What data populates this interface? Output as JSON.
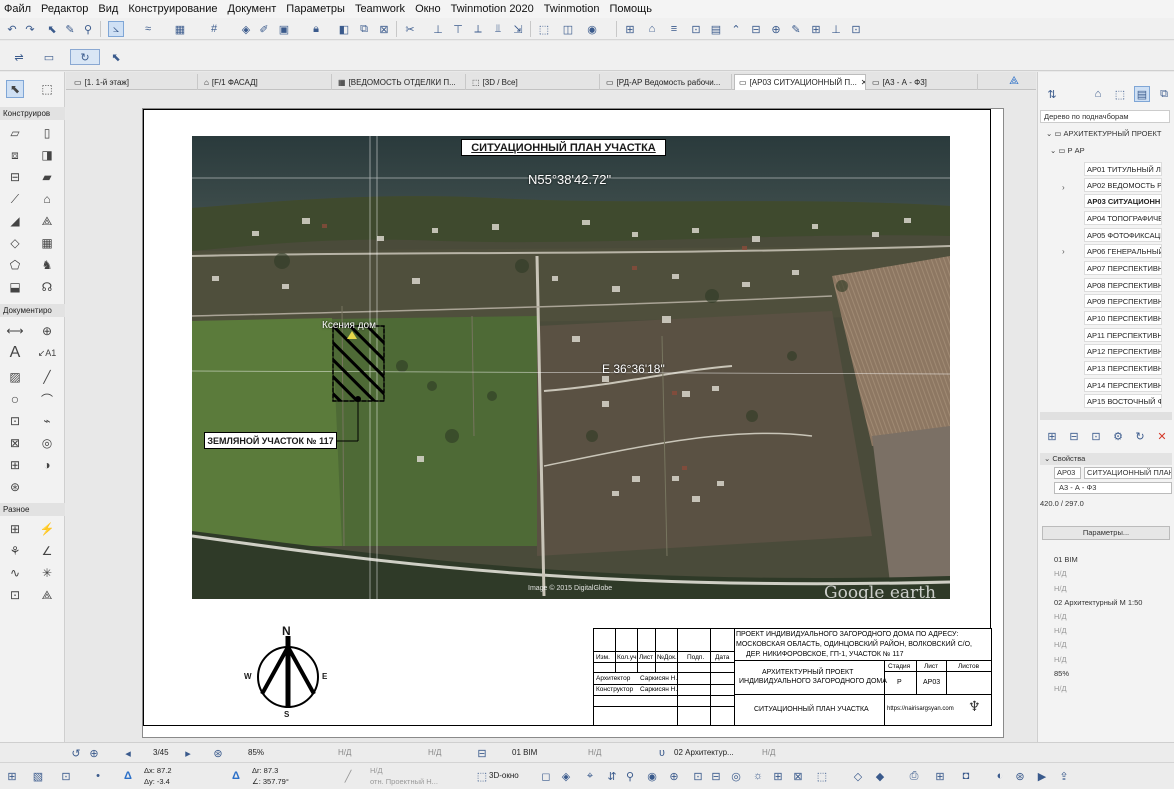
{
  "menu": [
    "Файл",
    "Редактор",
    "Вид",
    "Конструирование",
    "Документ",
    "Параметры",
    "Teamwork",
    "Окно",
    "Twinmotion 2020",
    "Twinmotion",
    "Помощь"
  ],
  "left_panel": {
    "section_design": "Конструиров",
    "section_document": "Документиро",
    "section_misc": "Разное"
  },
  "tabs": [
    {
      "label": "[1. 1-й этаж]"
    },
    {
      "label": "[F/1 ФАСАД]"
    },
    {
      "label": "[ВЕДОМОСТЬ ОТДЕЛКИ П..."
    },
    {
      "label": "[3D / Все]"
    },
    {
      "label": "[РД-АР Ведомость рабочи..."
    },
    {
      "label": "[АР03 СИТУАЦИОННЫЙ П..."
    },
    {
      "label": "[А3 - А - Ф3]"
    }
  ],
  "drawing": {
    "title": "СИТУАЦИОННЫЙ ПЛАН УЧАСТКА",
    "coord_north": "N55°38'42.72\"",
    "coord_east": "E 36°36'18\"",
    "place_label": "Ксения дом",
    "plot_label": "ЗЕМЛЯНОЙ УЧАСТОК № 117",
    "imagery_credit": "Image © 2015 DigitalGlobe",
    "watermark": "Google earth",
    "compass": {
      "n": "N",
      "s": "S",
      "w": "W",
      "e": "E"
    }
  },
  "stamp": {
    "project": "ПРОЕКТ ИНДИВИДУАЛЬНОГО ЗАГОРОДНОГО ДОМА ПО АДРЕСУ:",
    "address1": "МОСКОВСКАЯ ОБЛАСТЬ, ОДИНЦОВСКИЙ РАЙОН, ВОЛКОВСКИЙ С/О,",
    "address2": "ДЕР. НИКИФОРОВСКОЕ, ГП-1, УЧАСТОК № 117",
    "col_headers": [
      "Изм.",
      "Кол.уч",
      "Лист",
      "№Док.",
      "Подп.",
      "Дата"
    ],
    "role1": "Архитектор",
    "name1": "Саркисян Н.",
    "role2": "Конструктор",
    "name2": "Саркисян Н.",
    "section_title1": "АРХИТЕКТУРНЫЙ ПРОЕКТ",
    "section_title2": "ИНДИВИДУАЛЬНОГО ЗАГОРОДНОГО ДОМА",
    "stage_label": "Стадия",
    "sheet_label": "Лист",
    "sheets_label": "Листов",
    "stage": "Р",
    "sheet": "АР03",
    "drawing_name": "СИТУАЦИОННЫЙ ПЛАН УЧАСТКА",
    "website": "https://nairisargsyan.com"
  },
  "right_panel": {
    "dropdown": "Дерево по подначборам",
    "tree": [
      {
        "label": "АРХИТЕКТУРНЫЙ ПРОЕКТ"
      },
      {
        "label": "Р АР"
      },
      {
        "label": "АР01 ТИТУЛЬНЫЙ ЛИ"
      },
      {
        "label": "АР02 ВЕДОМОСТЬ РА"
      },
      {
        "label": "АР03 СИТУАЦИОНН"
      },
      {
        "label": "АР04 ТОПОГРАФИЧЕС"
      },
      {
        "label": "АР05 ФОТОФИКСАЦИ"
      },
      {
        "label": "АР06 ГЕНЕРАЛЬНЫЙ П"
      },
      {
        "label": "АР07 ПЕРСПЕКТИВН"
      },
      {
        "label": "АР08 ПЕРСПЕКТИВН"
      },
      {
        "label": "АР09 ПЕРСПЕКТИВН"
      },
      {
        "label": "АР10 ПЕРСПЕКТИВН"
      },
      {
        "label": "АР11 ПЕРСПЕКТИВН"
      },
      {
        "label": "АР12 ПЕРСПЕКТИВН"
      },
      {
        "label": "АР13 ПЕРСПЕКТИВН"
      },
      {
        "label": "АР14 ПЕРСПЕКТИВН"
      },
      {
        "label": "АР15 ВОСТОЧНЫЙ Ф"
      }
    ],
    "properties_header": "Свойства",
    "prop_id": "АР03",
    "prop_name": "СИТУАЦИОННЫЙ ПЛАН",
    "prop_layout": "А3 - А - Ф3",
    "prop_size": "420.0 / 297.0",
    "params_button": "Параметры...",
    "layers": [
      "01 BIM",
      "Н/Д",
      "Н/Д",
      "02 Архитектурный М 1:50",
      "Н/Д",
      "Н/Д",
      "Н/Д",
      "Н/Д",
      "85%",
      "Н/Д"
    ]
  },
  "status": {
    "page": "3/45",
    "zoom": "85%",
    "nd1": "Н/Д",
    "nd2": "Н/Д",
    "layer": "01 BIM",
    "nd3": "Н/Д",
    "arch": "02 Архитектур...",
    "nd4": "Н/Д"
  },
  "bottom": {
    "dx": "Δx: 87.2",
    "dy": "Δy: -3.4",
    "r": "Δr: 87.3",
    "angle": "∠: 357.79°",
    "nd": "Н/Д",
    "ref": "отн. Проектный Н...",
    "view3d": "3D-окно"
  }
}
